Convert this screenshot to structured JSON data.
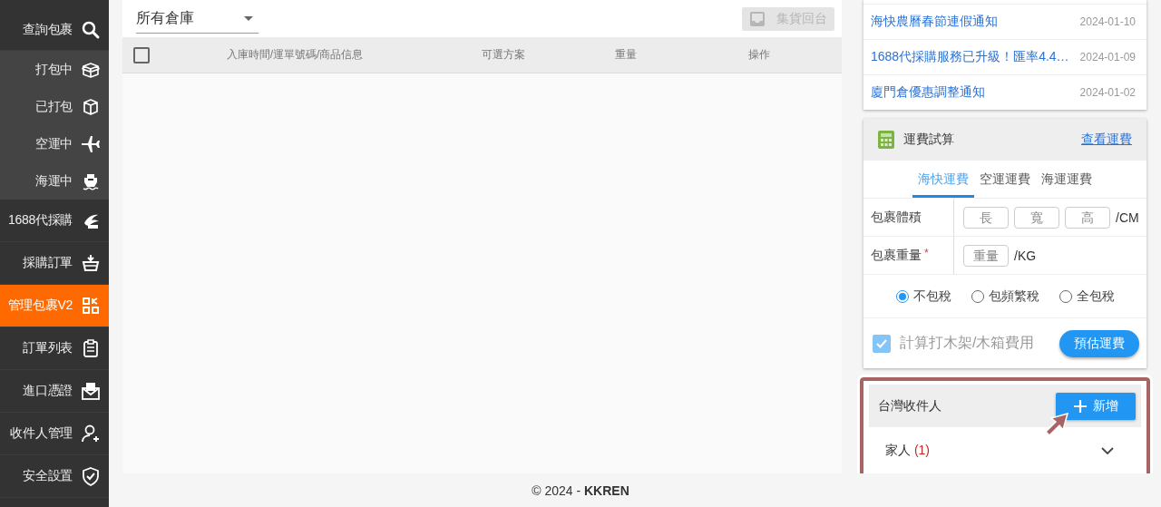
{
  "sidebar": {
    "items": [
      {
        "label": "查詢包裹",
        "kind": "main",
        "selected": false
      },
      {
        "label": "打包中",
        "kind": "sub",
        "selected": false
      },
      {
        "label": "已打包",
        "kind": "sub",
        "selected": false
      },
      {
        "label": "空運中",
        "kind": "sub",
        "selected": false
      },
      {
        "label": "海運中",
        "kind": "sub",
        "selected": false
      },
      {
        "label": "1688代採購",
        "kind": "main",
        "selected": false
      },
      {
        "label": "採購訂單",
        "kind": "main",
        "selected": false
      },
      {
        "label": "管理包裹V2",
        "kind": "main",
        "selected": true
      },
      {
        "label": "訂單列表",
        "kind": "main",
        "selected": false
      },
      {
        "label": "進口憑證",
        "kind": "main",
        "selected": false
      },
      {
        "label": "收件人管理",
        "kind": "main",
        "selected": false
      },
      {
        "label": "安全設置",
        "kind": "main",
        "selected": false
      }
    ]
  },
  "toolbar": {
    "warehouse_select": {
      "value": "所有倉庫"
    },
    "consolidate_button": {
      "label": "集貨回台",
      "disabled": true
    }
  },
  "table": {
    "select_all": {
      "checked": false
    },
    "columns": [
      "入庫時間/運單號碼/商品信息",
      "可選方案",
      "重量",
      "操作"
    ]
  },
  "notices": [
    {
      "title": "海快農曆春節連假通知",
      "date": "2024-01-10"
    },
    {
      "title": "1688代採購服務已升級！匯率4.4…",
      "date": "2024-01-09"
    },
    {
      "title": "廈門倉優惠調整通知",
      "date": "2024-01-02"
    }
  ],
  "freight": {
    "title": "運費試算",
    "link": "查看運費",
    "tabs": [
      {
        "label": "海快運費",
        "selected": true
      },
      {
        "label": "空運運費",
        "selected": false
      },
      {
        "label": "海運運費",
        "selected": false
      }
    ],
    "rows": [
      {
        "label": "包裹體積",
        "fields": [
          {
            "placeholder": "長"
          },
          {
            "placeholder": "寬"
          },
          {
            "placeholder": "高"
          }
        ],
        "unit": "/CM"
      },
      {
        "label": "包裹重量",
        "required_mark": "*",
        "fields": [
          {
            "placeholder": "重量"
          }
        ],
        "unit": "/KG"
      }
    ],
    "tax_options": [
      {
        "label": "不包稅",
        "selected": true
      },
      {
        "label": "包頻繁稅",
        "selected": false
      },
      {
        "label": "全包稅",
        "selected": false
      }
    ],
    "crate_option": {
      "label": "計算打木架/木箱費用",
      "checked": true,
      "disabled": true
    },
    "estimate_button": "預估運費"
  },
  "recipients": {
    "title": "台灣收件人",
    "add_button": "新增",
    "groups": [
      {
        "name": "家人",
        "count": "(1)",
        "expanded": false
      }
    ]
  },
  "footer": "© 2024 - **KKREN**"
}
